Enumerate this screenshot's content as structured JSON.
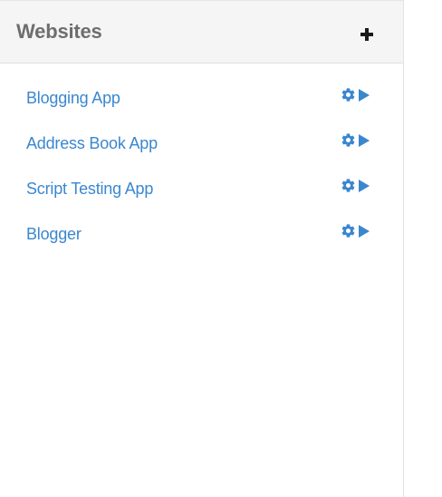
{
  "panel": {
    "title": "Websites",
    "add_icon": "plus-icon"
  },
  "websites": [
    {
      "label": "Blogging App",
      "settings_icon": "gear-icon",
      "launch_icon": "play-icon"
    },
    {
      "label": "Address Book App",
      "settings_icon": "gear-icon",
      "launch_icon": "play-icon"
    },
    {
      "label": "Script Testing App",
      "settings_icon": "gear-icon",
      "launch_icon": "play-icon"
    },
    {
      "label": "Blogger",
      "settings_icon": "gear-icon",
      "launch_icon": "play-icon"
    }
  ],
  "colors": {
    "link": "#3a87cf",
    "header_bg": "#f5f5f5",
    "header_text": "#6e6e6e"
  }
}
